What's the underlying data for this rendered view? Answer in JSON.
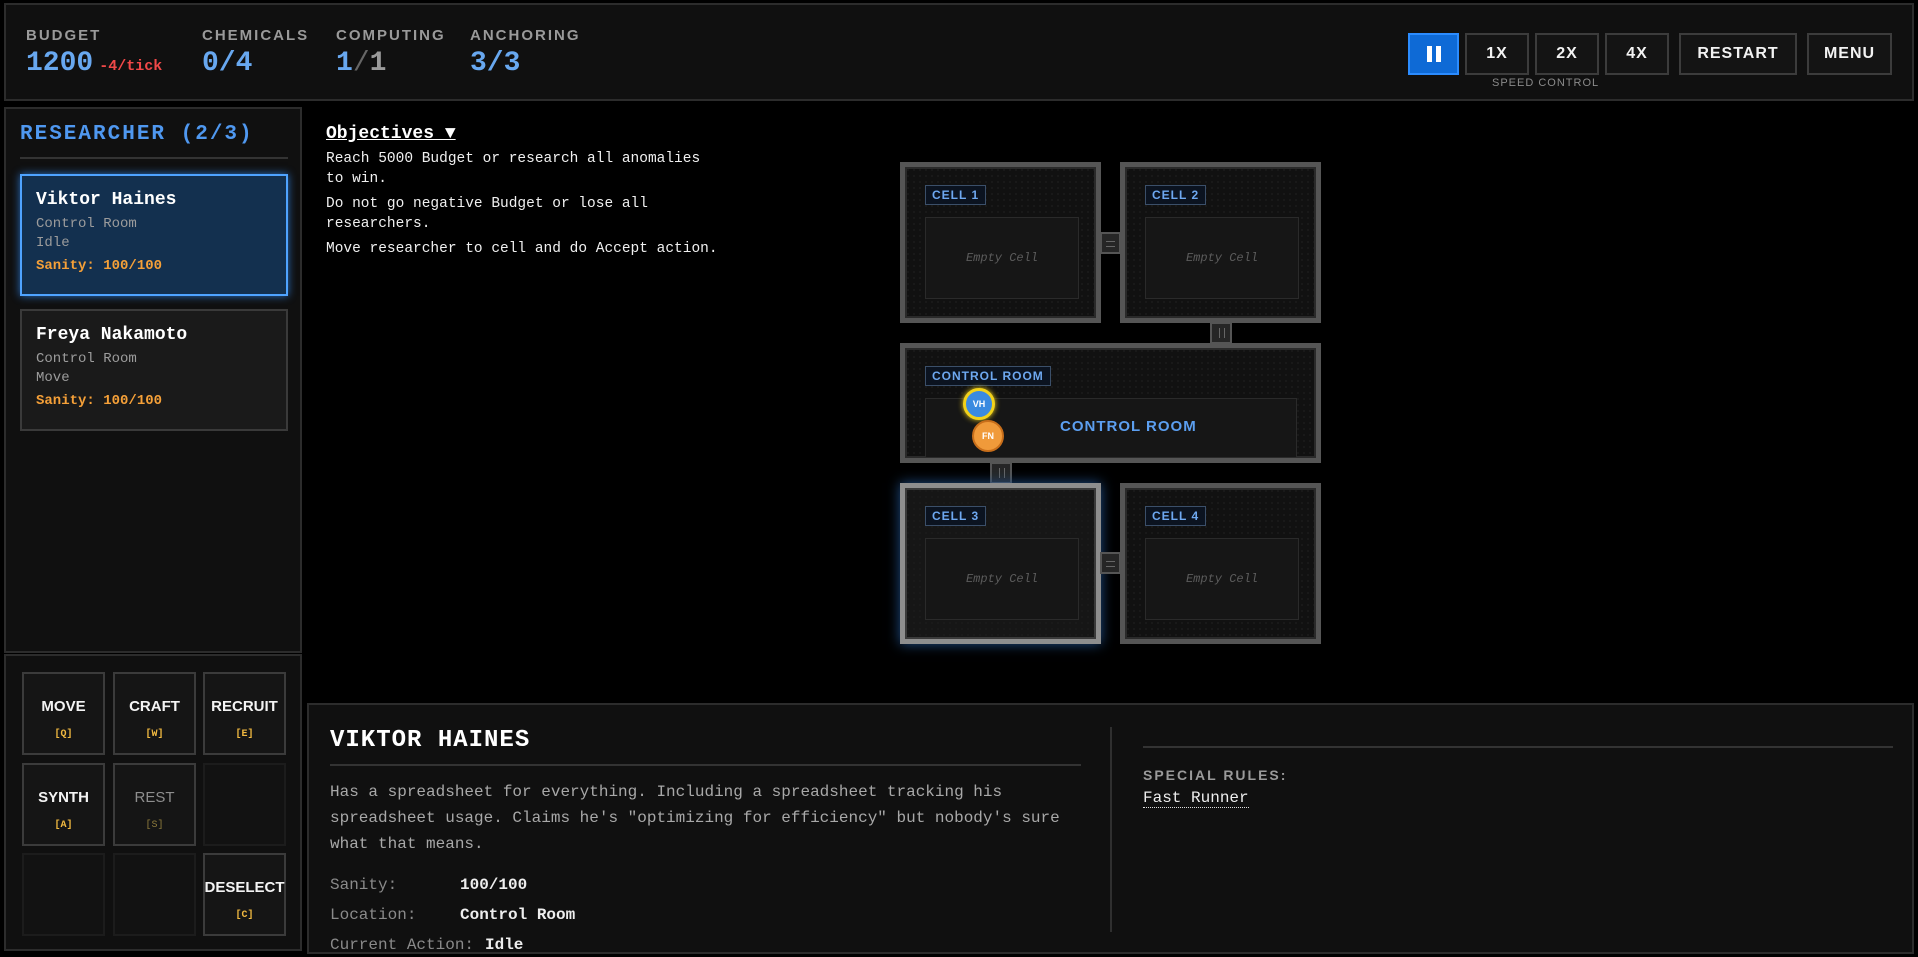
{
  "stats": {
    "budget": {
      "label": "BUDGET",
      "value": "1200",
      "delta": "-4/tick"
    },
    "chemicals": {
      "label": "CHEMICALS",
      "value": "0/4"
    },
    "computing": {
      "label": "COMPUTING",
      "current": "1",
      "sep": "/",
      "max": "1"
    },
    "anchoring": {
      "label": "ANCHORING",
      "value": "3/3"
    }
  },
  "speed": {
    "label": "SPEED CONTROL",
    "pause_icon": "pause-icon",
    "x1": "1X",
    "x2": "2X",
    "x4": "4X",
    "restart": "RESTART",
    "menu": "MENU"
  },
  "researchers": {
    "title": "RESEARCHER (2/3)",
    "list": [
      {
        "name": "Viktor Haines",
        "location": "Control Room",
        "action": "Idle",
        "sanity": "Sanity: 100/100",
        "initials": "VH"
      },
      {
        "name": "Freya Nakamoto",
        "location": "Control Room",
        "action": "Move",
        "sanity": "Sanity: 100/100",
        "initials": "FN"
      }
    ]
  },
  "actions": {
    "move": {
      "label": "MOVE",
      "key": "[Q]"
    },
    "craft": {
      "label": "CRAFT",
      "key": "[W]"
    },
    "recruit": {
      "label": "RECRUIT",
      "key": "[E]"
    },
    "synth": {
      "label": "SYNTH",
      "key": "[A]"
    },
    "rest": {
      "label": "REST",
      "key": "[S]"
    },
    "deselect": {
      "label": "DESELECT",
      "key": "[C]"
    }
  },
  "objectives": {
    "title": "Objectives ▼",
    "items": [
      "Reach 5000 Budget or research all anomalies to win.",
      "Do not go negative Budget or lose all researchers.",
      "Move researcher to cell and do Accept action."
    ]
  },
  "map": {
    "cells": [
      {
        "tag": "CELL 1",
        "content": "Empty Cell"
      },
      {
        "tag": "CELL 2",
        "content": "Empty Cell"
      },
      {
        "tag": "CELL 3",
        "content": "Empty Cell"
      },
      {
        "tag": "CELL 4",
        "content": "Empty Cell"
      }
    ],
    "control_room": {
      "tag": "CONTROL ROOM",
      "label": "CONTROL ROOM"
    }
  },
  "detail": {
    "name": "VIKTOR HAINES",
    "bio": "Has a spreadsheet for everything. Including a spreadsheet tracking his spreadsheet usage. Claims he's \"optimizing for efficiency\" but nobody's sure what that means.",
    "sanity_label": "Sanity:",
    "sanity_value": "100/100",
    "location_label": "Location:",
    "location_value": "Control Room",
    "action_label": "Current Action:",
    "action_value": "Idle",
    "rules_label": "SPECIAL RULES:",
    "rules_value": "Fast Runner"
  },
  "colors": {
    "accent": "#4f98f0",
    "selected_border": "#4fa3ff",
    "sanity": "#f5a038",
    "negative": "#f04848",
    "hotkey": "#f0b840",
    "selection_ring": "#f2d21a"
  }
}
